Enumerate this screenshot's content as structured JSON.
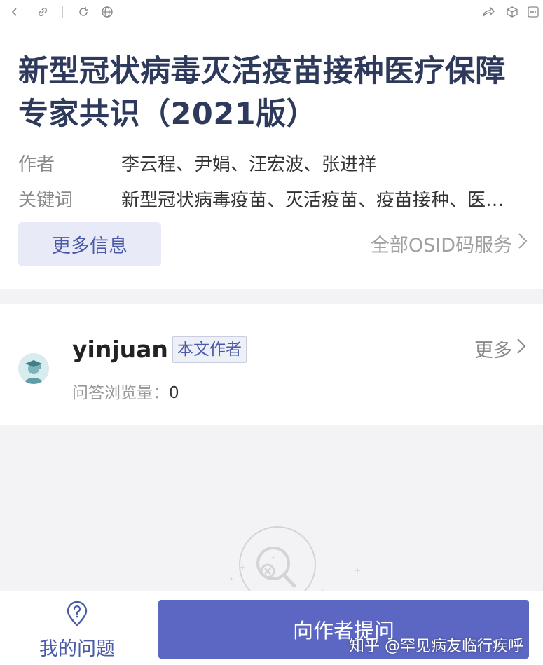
{
  "toolbar": {
    "icons": [
      "back-icon",
      "link-icon",
      "reload-icon",
      "globe-icon",
      "share-icon",
      "cube-icon",
      "more-icon"
    ]
  },
  "article": {
    "title": "新型冠状病毒灭活疫苗接种医疗保障专家共识（2021版）",
    "author_label": "作者",
    "authors": "李云程、尹娟、汪宏波、张进祥",
    "keywords_label": "关键词",
    "keywords": "新型冠状病毒疫苗、灭活疫苗、疫苗接种、医…",
    "more_info_button": "更多信息",
    "osid_link": "全部OSID码服务"
  },
  "author_section": {
    "name": "yinjuan",
    "badge": "本文作者",
    "more_label": "更多",
    "views_label": "问答浏览量：",
    "views_count": "0"
  },
  "bottom_bar": {
    "my_questions_label": "我的问题",
    "ask_button_label": "向作者提问"
  },
  "watermark": "知乎 @罕见病友临行疾呼",
  "colors": {
    "title": "#2e3a5c",
    "accent": "#5b67c2",
    "accent_light": "#e8ebf7"
  }
}
